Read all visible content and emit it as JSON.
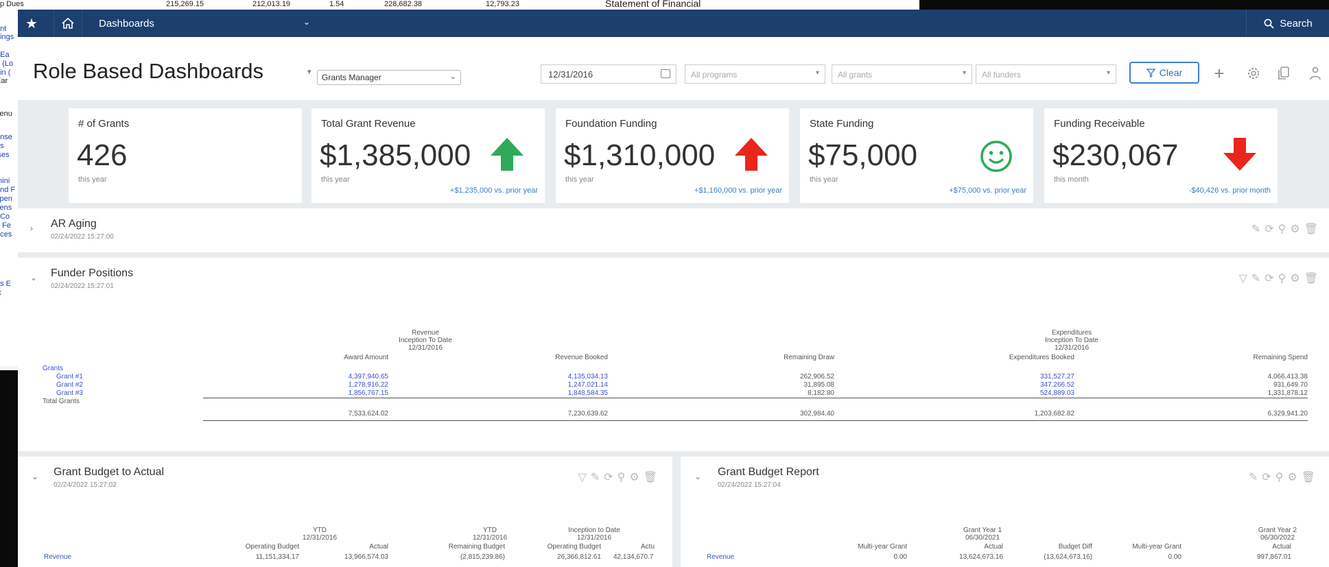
{
  "background": {
    "top_row": {
      "label": "p Dues",
      "values": [
        "215,269.15",
        "212,013.19",
        "1.54",
        "228,682.38",
        "12,793.23"
      ],
      "statement_title": "Statement of Financial"
    },
    "left_fragments": [
      "ant",
      "nings",
      "t Ea",
      "n (Lo",
      "ain (",
      "Ear",
      "venu",
      "ense",
      "es",
      "ises",
      "mini",
      "and F",
      "xpen",
      "cens",
      ", Co",
      "e Fe",
      "nces",
      ")",
      "us E",
      "ic"
    ]
  },
  "topbar": {
    "star_icon": "star-icon",
    "home_icon": "home-icon",
    "menu_label": "Dashboards",
    "search_label": "Search"
  },
  "header": {
    "title": "Role Based Dashboards",
    "role_value": "Grants Manager",
    "date_value": "12/31/2016",
    "programs_placeholder": "All programs",
    "grants_placeholder": "All grants",
    "funders_placeholder": "All funders",
    "clear_label": "Clear"
  },
  "kpis": [
    {
      "label": "# of Grants",
      "value": "426",
      "sub": "this year",
      "comparison": "",
      "indicator": "none"
    },
    {
      "label": "Total Grant Revenue",
      "value": "$1,385,000",
      "sub": "this year",
      "comparison": "+$1,235,000 vs. prior year",
      "indicator": "up-green"
    },
    {
      "label": "Foundation Funding",
      "value": "$1,310,000",
      "sub": "this year",
      "comparison": "+$1,160,000 vs. prior year",
      "indicator": "up-red"
    },
    {
      "label": "State Funding",
      "value": "$75,000",
      "sub": "this year",
      "comparison": "+$75,000 vs. prior year",
      "indicator": "smiley-green"
    },
    {
      "label": "Funding Receivable",
      "value": "$230,067",
      "sub": "this month",
      "comparison": "-$40,426 vs. prior month",
      "indicator": "down-red"
    }
  ],
  "ar_aging": {
    "title": "AR Aging",
    "timestamp": "02/24/2022 15:27:00"
  },
  "funder_positions": {
    "title": "Funder Positions",
    "timestamp": "02/24/2022 15:27:01",
    "revenue_header": [
      "Revenue",
      "Inception To Date",
      "12/31/2016"
    ],
    "expenditures_header": [
      "Expenditures",
      "Inception To Date",
      "12/31/2016"
    ],
    "columns": [
      "Award Amount",
      "Revenue Booked",
      "Remaining Draw",
      "Expenditures Booked",
      "Remaining Spend"
    ],
    "group_label": "Grants",
    "rows": [
      {
        "name": "Grant #1",
        "values": [
          "4,397,940.65",
          "4,135,034.13",
          "262,906.52",
          "331,527.27",
          "4,066,413.38"
        ]
      },
      {
        "name": "Grant #2",
        "values": [
          "1,278,916.22",
          "1,247,021.14",
          "31,895.08",
          "347,266.52",
          "931,649.70"
        ]
      },
      {
        "name": "Grant #3",
        "values": [
          "1,856,767.15",
          "1,848,584.35",
          "8,182.80",
          "524,889.03",
          "1,331,878.12"
        ]
      }
    ],
    "total": {
      "name": "Total Grants",
      "values": [
        "7,533,624.02",
        "7,230,639.62",
        "302,984.40",
        "1,203,682.82",
        "6,329,941.20"
      ]
    }
  },
  "budget_to_actual": {
    "title": "Grant Budget to Actual",
    "timestamp": "02/24/2022 15:27:02",
    "group1": [
      "YTD",
      "12/31/2016"
    ],
    "group2": [
      "YTD",
      "12/31/2016"
    ],
    "group3": [
      "Inception to Date",
      "12/31/2016"
    ],
    "columns": [
      "Operating Budget",
      "Actual",
      "Remaining Budget",
      "Operating Budget",
      "Actu"
    ],
    "row_label": "Revenue",
    "row_values": [
      "11,151,334.17",
      "13,966,574.03",
      "(2,815,239.86)",
      "26,366,812.61",
      "42,134,670.7"
    ]
  },
  "budget_report": {
    "title": "Grant Budget Report",
    "timestamp": "02/24/2022 15:27:04",
    "group1": [
      "Grant Year 1",
      "06/30/2021"
    ],
    "group2": [
      "Grant Year 2",
      "06/30/2022"
    ],
    "columns": [
      "Multi-year Grant",
      "Actual",
      "Budget Diff",
      "Multi-year Grant",
      "Actual"
    ],
    "row_label": "Revenue",
    "row_values": [
      "0.00",
      "13,624,673.16",
      "(13,624,673.16)",
      "0.00",
      "997,867.01"
    ]
  },
  "colors": {
    "topbar": "#1c3f6e",
    "accent": "#3b7fd0",
    "up_green": "#2eaa5a",
    "red": "#e8261c"
  }
}
